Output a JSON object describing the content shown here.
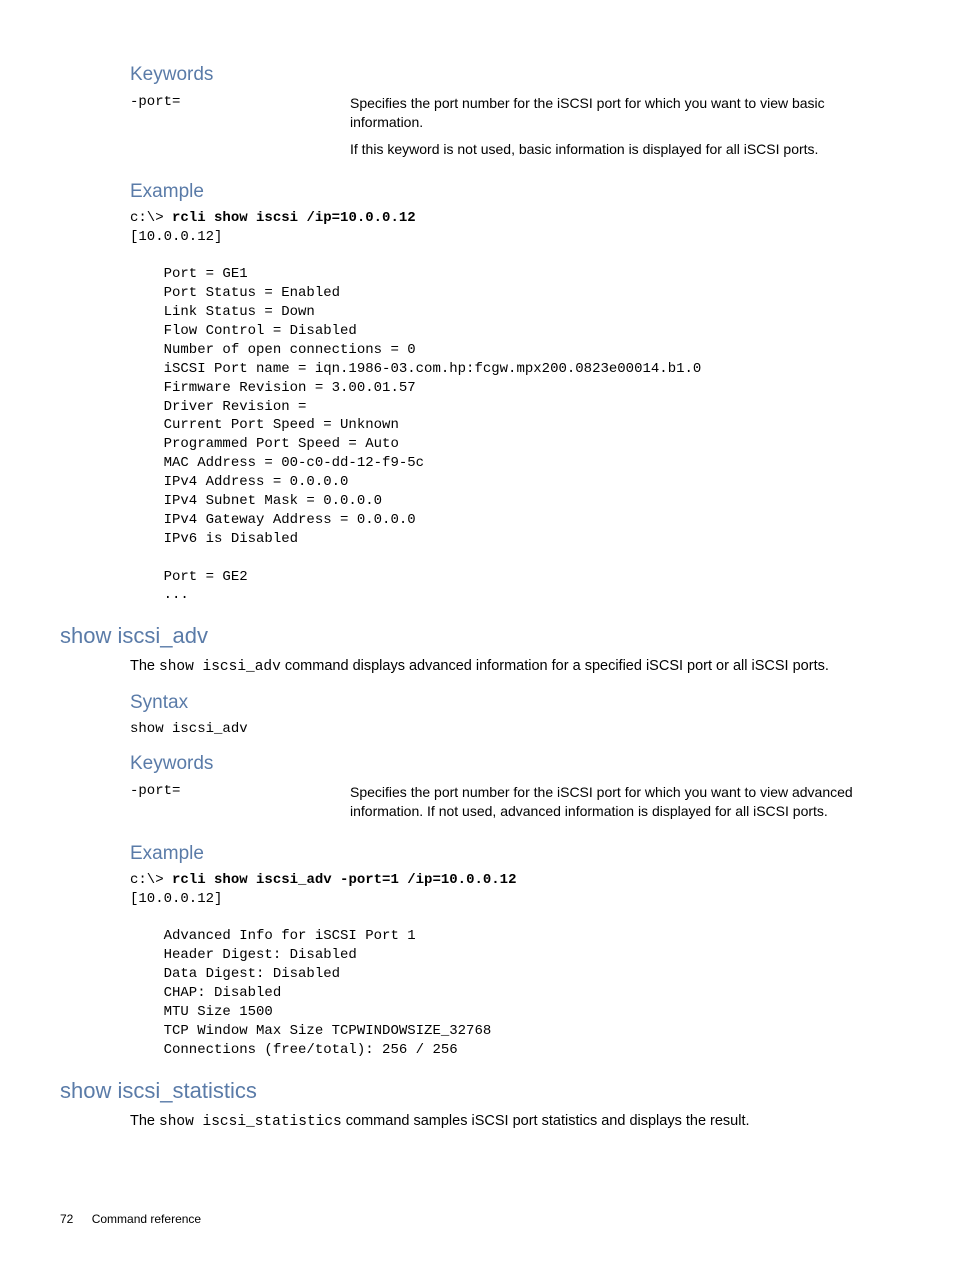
{
  "section1": {
    "keywords_h": "Keywords",
    "kw_label": "-port=",
    "kw_desc1": "Specifies the port number for the iSCSI port for which you want to view basic information.",
    "kw_desc2": "If this keyword is not used, basic information is displayed for all iSCSI ports.",
    "example_h": "Example",
    "ex_prompt": "c:\\> ",
    "ex_cmd": "rcli show iscsi /ip=10.0.0.12",
    "ex_body": "[10.0.0.12]\n\n    Port = GE1\n    Port Status = Enabled\n    Link Status = Down\n    Flow Control = Disabled\n    Number of open connections = 0\n    iSCSI Port name = iqn.1986-03.com.hp:fcgw.mpx200.0823e00014.b1.0\n    Firmware Revision = 3.00.01.57\n    Driver Revision =\n    Current Port Speed = Unknown\n    Programmed Port Speed = Auto\n    MAC Address = 00-c0-dd-12-f9-5c\n    IPv4 Address = 0.0.0.0\n    IPv4 Subnet Mask = 0.0.0.0\n    IPv4 Gateway Address = 0.0.0.0\n    IPv6 is Disabled\n\n    Port = GE2\n    ..."
  },
  "section2": {
    "title": "show iscsi_adv",
    "intro_before": "The ",
    "intro_code": "show iscsi_adv",
    "intro_after": " command displays advanced information for a specified iSCSI port or all iSCSI ports.",
    "syntax_h": "Syntax",
    "syntax_code": "show iscsi_adv",
    "keywords_h": "Keywords",
    "kw_label": "-port=",
    "kw_desc": "Specifies the port number for the iSCSI port for which you want to view advanced information. If not used, advanced information is displayed for all iSCSI ports.",
    "example_h": "Example",
    "ex_prompt": "c:\\> ",
    "ex_cmd": "rcli show iscsi_adv -port=1 /ip=10.0.0.12",
    "ex_body": "[10.0.0.12]\n\n    Advanced Info for iSCSI Port 1\n    Header Digest: Disabled\n    Data Digest: Disabled\n    CHAP: Disabled\n    MTU Size 1500\n    TCP Window Max Size TCPWINDOWSIZE_32768\n    Connections (free/total): 256 / 256"
  },
  "section3": {
    "title": "show iscsi_statistics",
    "intro_before": "The ",
    "intro_code": "show iscsi_statistics",
    "intro_after": " command samples iSCSI port statistics and displays the result."
  },
  "footer": {
    "page": "72",
    "chapter": "Command reference"
  }
}
